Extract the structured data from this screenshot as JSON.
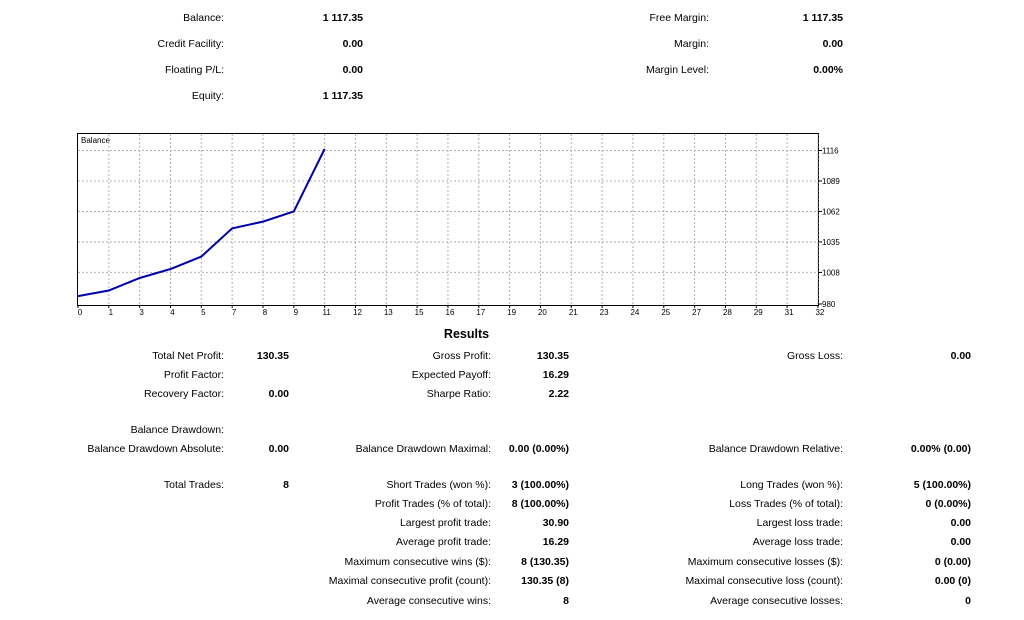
{
  "summary": {
    "balance_label": "Balance:",
    "balance": "1 117.35",
    "credit_label": "Credit Facility:",
    "credit": "0.00",
    "floating_label": "Floating P/L:",
    "floating": "0.00",
    "equity_label": "Equity:",
    "equity": "1 117.35",
    "free_margin_label": "Free Margin:",
    "free_margin": "1 117.35",
    "margin_label": "Margin:",
    "margin": "0.00",
    "margin_level_label": "Margin Level:",
    "margin_level": "0.00%"
  },
  "chart_data": {
    "type": "line",
    "title": "Balance",
    "x_ticks": [
      "0",
      "1",
      "3",
      "4",
      "5",
      "7",
      "8",
      "9",
      "11",
      "12",
      "13",
      "15",
      "16",
      "17",
      "19",
      "20",
      "21",
      "23",
      "24",
      "25",
      "27",
      "28",
      "29",
      "31",
      "32"
    ],
    "y_ticks": [
      "1116",
      "1089",
      "1062",
      "1035",
      "1008",
      "980"
    ],
    "ylim": [
      980,
      1116
    ],
    "series": [
      {
        "x": [
          0,
          1,
          2,
          3,
          4,
          5,
          6,
          7,
          8
        ],
        "y": [
          987,
          992,
          1003,
          1011,
          1022,
          1047,
          1053,
          1062,
          1117.35
        ]
      }
    ],
    "grid": true,
    "line_color": "#0000aa"
  },
  "results": {
    "title": "Results",
    "total_net_profit_label": "Total Net Profit:",
    "total_net_profit": "130.35",
    "gross_profit_label": "Gross Profit:",
    "gross_profit": "130.35",
    "gross_loss_label": "Gross Loss:",
    "gross_loss": "0.00",
    "profit_factor_label": "Profit Factor:",
    "expected_payoff_label": "Expected Payoff:",
    "expected_payoff": "16.29",
    "recovery_factor_label": "Recovery Factor:",
    "recovery_factor": "0.00",
    "sharpe_ratio_label": "Sharpe Ratio:",
    "sharpe_ratio": "2.22",
    "balance_drawdown_label": "Balance Drawdown:",
    "bd_absolute_label": "Balance Drawdown Absolute:",
    "bd_absolute": "0.00",
    "bd_maximal_label": "Balance Drawdown Maximal:",
    "bd_maximal": "0.00 (0.00%)",
    "bd_relative_label": "Balance Drawdown Relative:",
    "bd_relative": "0.00% (0.00)",
    "total_trades_label": "Total Trades:",
    "total_trades": "8",
    "short_trades_label": "Short Trades (won %):",
    "short_trades": "3 (100.00%)",
    "long_trades_label": "Long Trades (won %):",
    "long_trades": "5 (100.00%)",
    "profit_trades_label": "Profit Trades (% of total):",
    "profit_trades": "8 (100.00%)",
    "loss_trades_label": "Loss Trades (% of total):",
    "loss_trades": "0 (0.00%)",
    "largest_profit_label": "Largest profit trade:",
    "largest_profit": "30.90",
    "largest_loss_label": "Largest loss trade:",
    "largest_loss": "0.00",
    "average_profit_label": "Average profit trade:",
    "average_profit": "16.29",
    "average_loss_label": "Average loss trade:",
    "average_loss": "0.00",
    "max_consec_wins_label": "Maximum consecutive wins ($):",
    "max_consec_wins": "8 (130.35)",
    "max_consec_losses_label": "Maximum consecutive losses ($):",
    "max_consec_losses": "0 (0.00)",
    "maximal_consec_profit_label": "Maximal consecutive profit (count):",
    "maximal_consec_profit": "130.35 (8)",
    "maximal_consec_loss_label": "Maximal consecutive loss (count):",
    "maximal_consec_loss": "0.00 (0)",
    "avg_consec_wins_label": "Average consecutive wins:",
    "avg_consec_wins": "8",
    "avg_consec_losses_label": "Average consecutive losses:",
    "avg_consec_losses": "0"
  }
}
